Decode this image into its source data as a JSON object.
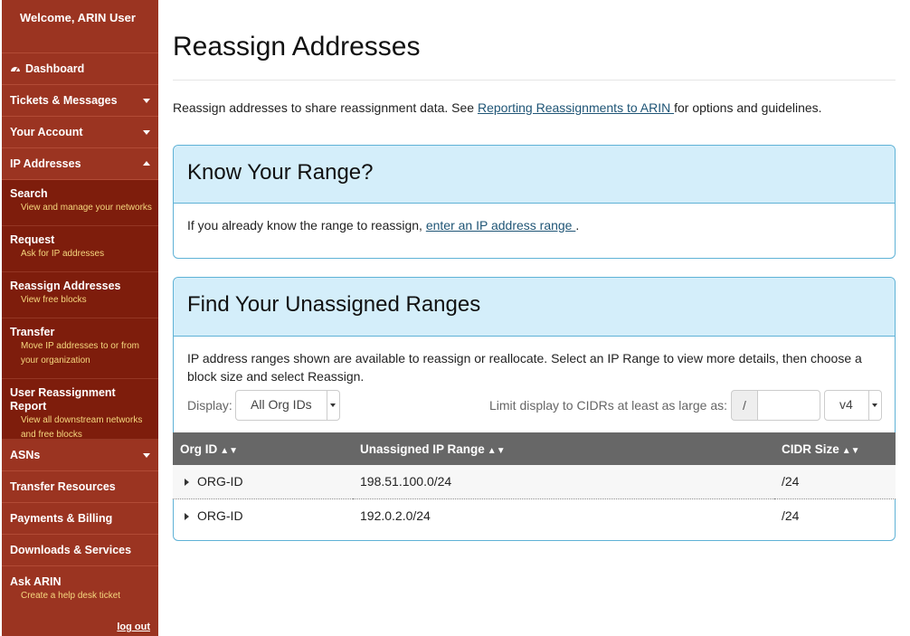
{
  "sidebar": {
    "welcome": "Welcome, ARIN User",
    "dashboard": "Dashboard",
    "tickets": "Tickets & Messages",
    "account": "Your Account",
    "ip": "IP Addresses",
    "sub": [
      {
        "title": "Search",
        "desc": "View and manage your networks"
      },
      {
        "title": "Request",
        "desc": "Ask for IP addresses"
      },
      {
        "title": "Reassign Addresses",
        "desc": "View free blocks"
      },
      {
        "title": "Transfer",
        "desc": "Move IP addresses to or from your organization"
      },
      {
        "title": "User Reassignment Report",
        "desc": "View all downstream networks and free blocks"
      }
    ],
    "asns": "ASNs",
    "transfer_resources": "Transfer Resources",
    "payments": "Payments & Billing",
    "downloads": "Downloads & Services",
    "ask_title": "Ask ARIN",
    "ask_desc": "Create a help desk ticket",
    "logout": "log out"
  },
  "main": {
    "title": "Reassign Addresses",
    "intro_pre": "Reassign addresses to share reassignment data. See ",
    "intro_link": "Reporting Reassignments to ARIN ",
    "intro_post": "for options and guidelines.",
    "know": {
      "heading": "Know Your Range?",
      "text_pre": "If you already know the range to reassign, ",
      "link": "enter an IP address range ",
      "text_post": "."
    },
    "find": {
      "heading": "Find Your Unassigned Ranges",
      "desc": "IP address ranges shown are available to reassign or reallocate. Select an IP Range to view more details, then choose a block size and select Reassign.",
      "display_label": "Display:",
      "display_value": "All Org IDs",
      "limit_label": "Limit display to CIDRs at least as large as:",
      "slash": "/",
      "cidr_value": "",
      "version_value": "v4",
      "columns": [
        "Org ID",
        "Unassigned IP Range",
        "CIDR Size"
      ],
      "rows": [
        {
          "org": "ORG-ID",
          "range": "198.51.100.0/24",
          "cidr": "/24"
        },
        {
          "org": "ORG-ID",
          "range": "192.0.2.0/24",
          "cidr": "/24"
        }
      ]
    }
  }
}
